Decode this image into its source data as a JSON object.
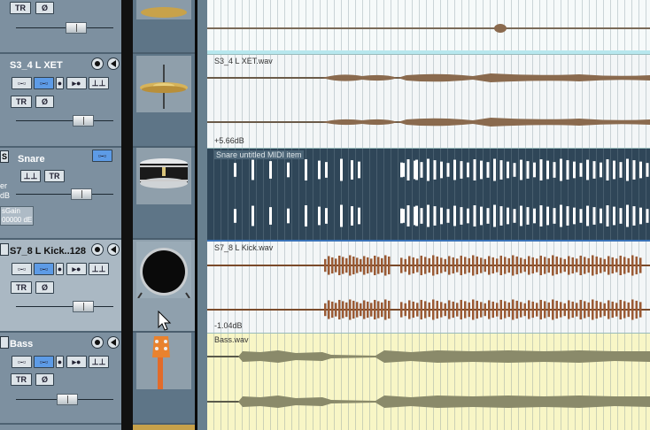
{
  "tracks": [
    {
      "name": "",
      "tr": "TR",
      "phase": "Ø"
    },
    {
      "name": "S3_4 L XET",
      "tr": "TR",
      "phase": "Ø"
    },
    {
      "name": "Snare",
      "edge": "S",
      "tr": "TR",
      "side_text": "er",
      "db_text": "dB",
      "gain_label": "sGain",
      "gain_value": "00000 dE"
    },
    {
      "name": "S7_8 L Kick..128",
      "tr": "TR",
      "phase": "Ø"
    },
    {
      "name": "Bass",
      "tr": "TR",
      "phase": "Ø"
    },
    {
      "name": ""
    }
  ],
  "clips": [
    {
      "name": "",
      "gain": ""
    },
    {
      "name": "S3_4 L XET.wav",
      "gain": "+5.66dB"
    },
    {
      "name": "Snare untitled MIDI item",
      "gain": ""
    },
    {
      "name": "S7_8 L Kick.wav",
      "gain": "-1.04dB"
    },
    {
      "name": "Bass.wav",
      "gain": ""
    }
  ],
  "icons": {
    "record_arm": "record-arm-icon",
    "mute": "speaker-icon",
    "pointer": "mouse-pointer-icon"
  },
  "colors": {
    "selected_track": "#aab8c3",
    "active_button": "#5d9be6",
    "cymbal_clip": "#f6fafa",
    "snare_clip": "#2f4658",
    "kick_clip": "#f3f6f7",
    "bass_clip": "#f8f6c6",
    "wave_audio": "#8a6a4e",
    "wave_kick": "#9a5a34",
    "wave_bass": "#8a8a6a"
  }
}
